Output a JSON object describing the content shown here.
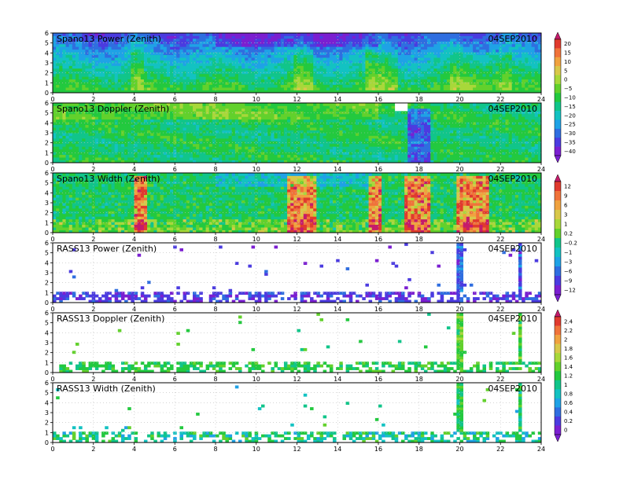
{
  "chart_data": [
    {
      "type": "heatmap",
      "title": "Spano13 Power (Zenith)",
      "date": "04SEP2010",
      "field": "spower",
      "x_ticks": [
        "0",
        "2",
        "4",
        "6",
        "8",
        "10",
        "12",
        "14",
        "16",
        "18",
        "20",
        "22",
        "24"
      ],
      "y_ticks": [
        "0",
        "1",
        "2",
        "3",
        "4",
        "5",
        "6"
      ],
      "xlim": [
        0,
        24
      ],
      "ylim": [
        0,
        6
      ]
    },
    {
      "type": "heatmap",
      "title": "Spano13 Doppler (Zenith)",
      "date": "04SEP2010",
      "field": "sdoppler",
      "x_ticks": [
        "0",
        "2",
        "4",
        "6",
        "8",
        "10",
        "12",
        "14",
        "16",
        "18",
        "20",
        "22",
        "24"
      ],
      "y_ticks": [
        "0",
        "1",
        "2",
        "3",
        "4",
        "5",
        "6"
      ],
      "xlim": [
        0,
        24
      ],
      "ylim": [
        0,
        6
      ]
    },
    {
      "type": "heatmap",
      "title": "Spano13 Width (Zenith)",
      "date": "04SEP2010",
      "field": "swidth",
      "x_ticks": [
        "0",
        "2",
        "4",
        "6",
        "8",
        "10",
        "12",
        "14",
        "16",
        "18",
        "20",
        "22",
        "24"
      ],
      "y_ticks": [
        "0",
        "1",
        "2",
        "3",
        "4",
        "5",
        "6"
      ],
      "xlim": [
        0,
        24
      ],
      "ylim": [
        0,
        6
      ]
    },
    {
      "type": "heatmap",
      "title": "RASS13 Power (Zenith)",
      "date": "04SEP2010",
      "field": "rpower",
      "x_ticks": [
        "0",
        "2",
        "4",
        "6",
        "8",
        "10",
        "12",
        "14",
        "16",
        "18",
        "20",
        "22",
        "24"
      ],
      "y_ticks": [
        "0",
        "1",
        "2",
        "3",
        "4",
        "5",
        "6"
      ],
      "xlim": [
        0,
        24
      ],
      "ylim": [
        0,
        6
      ]
    },
    {
      "type": "heatmap",
      "title": "RASS13 Doppler (Zenith)",
      "date": "04SEP2010",
      "field": "rdoppler",
      "x_ticks": [
        "0",
        "2",
        "4",
        "6",
        "8",
        "10",
        "12",
        "14",
        "16",
        "18",
        "20",
        "22",
        "24"
      ],
      "y_ticks": [
        "0",
        "1",
        "2",
        "3",
        "4",
        "5",
        "6"
      ],
      "xlim": [
        0,
        24
      ],
      "ylim": [
        0,
        6
      ]
    },
    {
      "type": "heatmap",
      "title": "RASS13 Width (Zenith)",
      "date": "04SEP2010",
      "field": "rwidth",
      "x_ticks": [
        "0",
        "2",
        "4",
        "6",
        "8",
        "10",
        "12",
        "14",
        "16",
        "18",
        "20",
        "22",
        "24"
      ],
      "y_ticks": [
        "0",
        "1",
        "2",
        "3",
        "4",
        "5",
        "6"
      ],
      "xlim": [
        0,
        24
      ],
      "ylim": [
        0,
        6
      ]
    }
  ],
  "colorbars": [
    {
      "labels": [
        "20",
        "15",
        "10",
        "5",
        "0",
        "−5",
        "−10",
        "−15",
        "−20",
        "−25",
        "−30",
        "−35",
        "−40"
      ]
    },
    {
      "labels": [
        "12",
        "9",
        "6",
        "3",
        "1",
        "0.2",
        "−0.2",
        "−1",
        "−3",
        "−6",
        "−9",
        "−12"
      ]
    },
    {
      "labels": [
        "2.4",
        "2.2",
        "2",
        "1.8",
        "1.6",
        "1.4",
        "1.2",
        "1",
        "0.8",
        "0.6",
        "0.4",
        "0.2",
        "0"
      ]
    }
  ],
  "colors": {
    "scale": [
      "#7b1fd1",
      "#4b3be0",
      "#2f6ee0",
      "#1fa2e6",
      "#13c2c2",
      "#11c58a",
      "#23c93f",
      "#62d12c",
      "#a8d83a",
      "#d8c84a",
      "#f0a23f",
      "#f0733a",
      "#e03a2e",
      "#c51b6b"
    ],
    "grid": "#bbbbbb",
    "frame": "#000000"
  }
}
